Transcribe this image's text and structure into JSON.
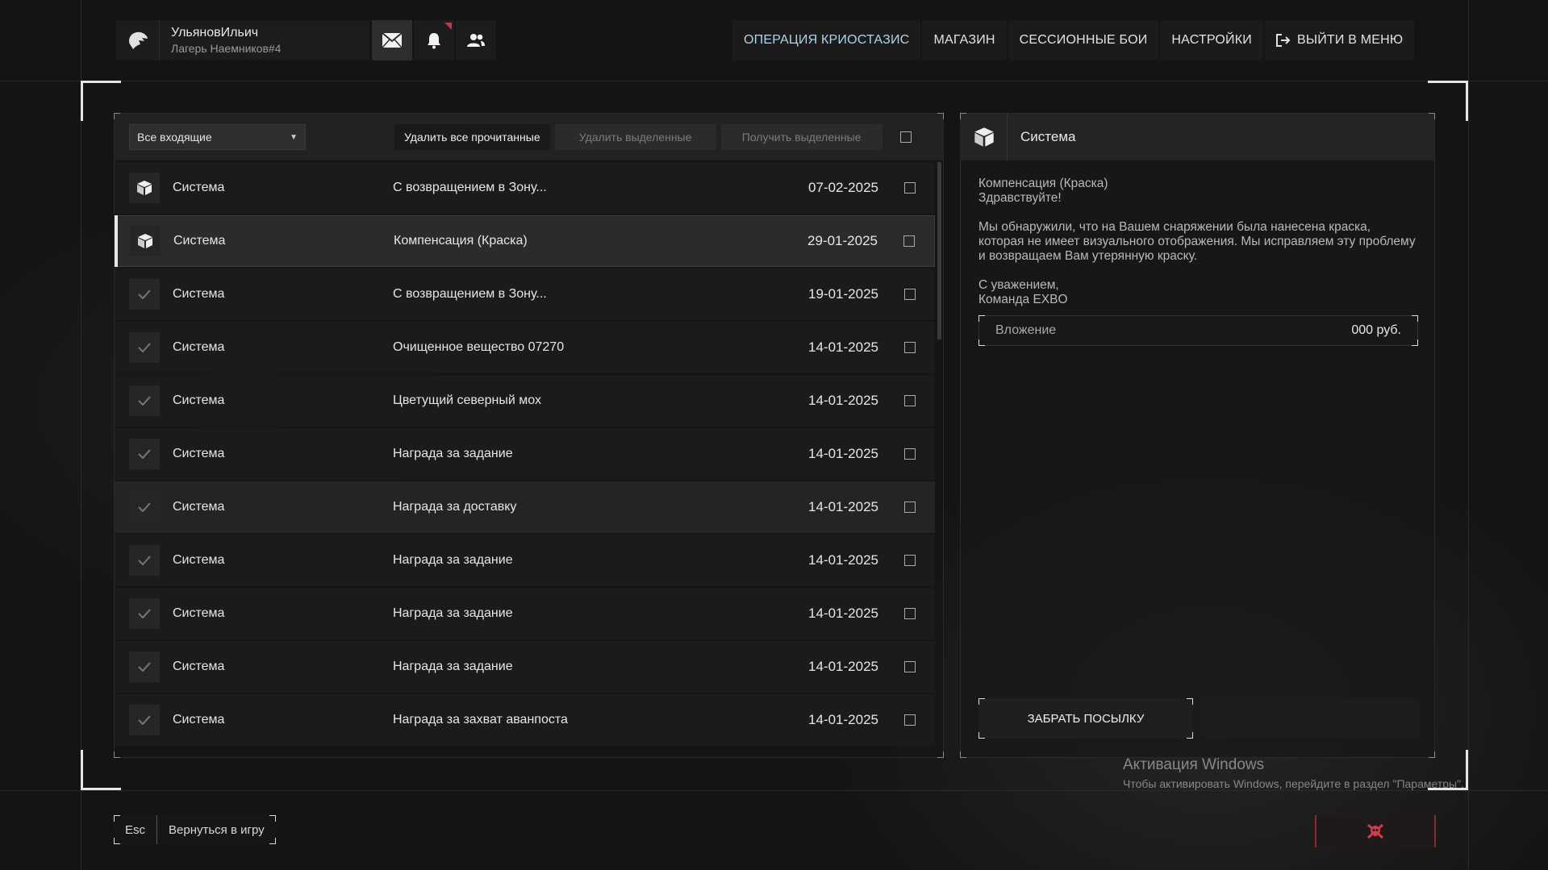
{
  "profile": {
    "name": "УльяновИльич",
    "tag": "Лагерь Наемников#4"
  },
  "nav": [
    {
      "label": "ОПЕРАЦИЯ КРИОСТАЗИС"
    },
    {
      "label": "МАГАЗИН"
    },
    {
      "label": "СЕССИОННЫЕ БОИ"
    },
    {
      "label": "НАСТРОЙКИ"
    },
    {
      "label": "ВЫЙТИ В МЕНЮ"
    }
  ],
  "toolbar": {
    "filter_value": "Все входящие",
    "delete_read": "Удалить все прочитанные",
    "delete_selected": "Удалить выделенные",
    "get_selected": "Получить выделенные"
  },
  "messages": [
    {
      "sender": "Система",
      "subject": "С возвращением в Зону...",
      "date": "07-02-2025",
      "icon": "package-icon"
    },
    {
      "sender": "Система",
      "subject": "Компенсация (Краска)",
      "date": "29-01-2025",
      "icon": "package-icon"
    },
    {
      "sender": "Система",
      "subject": "С возвращением в Зону...",
      "date": "19-01-2025",
      "icon": "check-icon"
    },
    {
      "sender": "Система",
      "subject": "Очищенное вещество 07270",
      "date": "14-01-2025",
      "icon": "check-icon"
    },
    {
      "sender": "Система",
      "subject": "Цветущий северный мох",
      "date": "14-01-2025",
      "icon": "check-icon"
    },
    {
      "sender": "Система",
      "subject": "Награда за задание",
      "date": "14-01-2025",
      "icon": "check-icon"
    },
    {
      "sender": "Система",
      "subject": "Награда за доставку",
      "date": "14-01-2025",
      "icon": "check-icon"
    },
    {
      "sender": "Система",
      "subject": "Награда за задание",
      "date": "14-01-2025",
      "icon": "check-icon"
    },
    {
      "sender": "Система",
      "subject": "Награда за задание",
      "date": "14-01-2025",
      "icon": "check-icon"
    },
    {
      "sender": "Система",
      "subject": "Награда за задание",
      "date": "14-01-2025",
      "icon": "check-icon"
    },
    {
      "sender": "Система",
      "subject": "Награда за захват аванпоста",
      "date": "14-01-2025",
      "icon": "check-icon"
    }
  ],
  "detail": {
    "sender": "Система",
    "subject": "Компенсация (Краска)",
    "greeting": "Здравствуйте!",
    "body": "Мы обнаружили, что на Вашем снаряжении была нанесена краска, которая не имеет визуального отображения. Мы исправляем эту проблему и возвращаем Вам утерянную краску.",
    "sign1": "С уважением,",
    "sign2": "Команда EXBO",
    "attachment_label": "Вложение",
    "attachment_value": "000 руб.",
    "claim_button": "ЗАБРАТЬ ПОСЫЛКУ"
  },
  "windows_activation": {
    "title": "Активация Windows",
    "text": "Чтобы активировать Windows, перейдите в раздел \"Параметры\"."
  },
  "bottom": {
    "esc_key": "Esc",
    "back_label": "Вернуться в игру"
  },
  "colors": {
    "accent_nav": "#a9d6f0",
    "notif": "#c0394a",
    "exit": "#8a2a32"
  }
}
